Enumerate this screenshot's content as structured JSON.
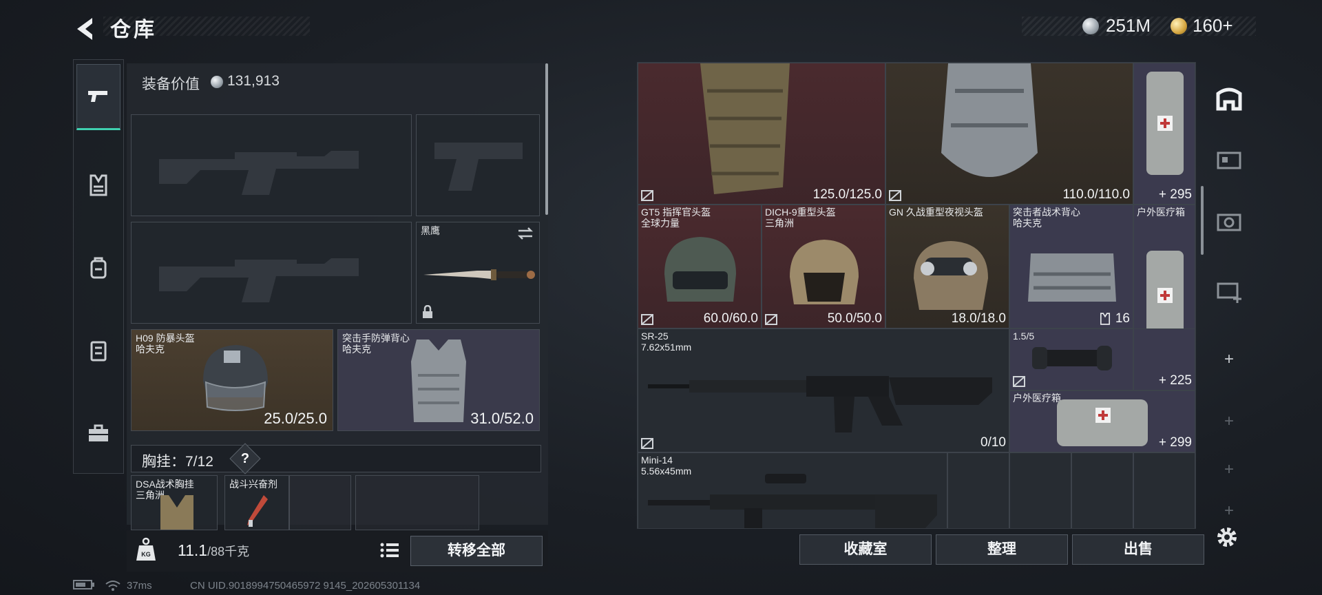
{
  "header": {
    "title": "仓库"
  },
  "currency": {
    "silver": "251M",
    "gold": "160+"
  },
  "loadout": {
    "equip_value_label": "装备价值",
    "equip_value": "131,913",
    "knife_name": "黑鹰",
    "helmet": {
      "name": "H09 防暴头盔",
      "map": "哈夫克",
      "durability": "25.0/25.0"
    },
    "armor": {
      "name": "突击手防弹背心",
      "map": "哈夫克",
      "durability": "31.0/52.0"
    },
    "rig_label": "胸挂：7/12",
    "rig_help": "?",
    "rig_items": [
      {
        "name": "DSA战术胸挂",
        "map": "三角洲"
      },
      {
        "name": "战斗兴奋剂",
        "map": ""
      }
    ],
    "weight": "11.1",
    "weight_unit": "/88千克",
    "transfer_all": "转移全部"
  },
  "stash": {
    "top_row": [
      {
        "val": "125.0/125.0"
      },
      {
        "val": "110.0/110.0"
      },
      {
        "val": "+ 295"
      }
    ],
    "helmets": [
      {
        "name": "GT5 指挥官头盔",
        "map": "全球力量",
        "val": "60.0/60.0"
      },
      {
        "name": "DICH-9重型头盔",
        "map": "三角洲",
        "val": "50.0/50.0"
      },
      {
        "name": "GN 久战重型夜视头盔",
        "map": "",
        "val": "18.0/18.0"
      },
      {
        "name": "突击者战术背心",
        "map": "哈夫克",
        "val": "16"
      },
      {
        "name": "户外医疗箱",
        "map": "",
        "val": ""
      }
    ],
    "sr25": {
      "name": "SR-25",
      "caliber": "7.62x51mm",
      "val": "0/10"
    },
    "scope": {
      "name": "1.5/5",
      "val": "+ 225"
    },
    "medkit2": {
      "name": "户外医疗箱",
      "val": "+ 299"
    },
    "mini14": {
      "name": "Mini-14",
      "caliber": "5.56x45mm"
    }
  },
  "actions": {
    "collection": "收藏室",
    "sort": "整理",
    "sell": "出售"
  },
  "status": {
    "ping": "37ms",
    "uid": "CN UID.9018994750465972 9145_202605301134"
  },
  "icons": [
    "back-arrow-icon",
    "silver-coin-icon",
    "gold-coin-icon",
    "pistol-icon",
    "rig-icon",
    "backpack-icon",
    "case-icon",
    "toolbox-icon",
    "swap-icon",
    "lock-icon",
    "weight-icon",
    "list-icon",
    "home-icon",
    "gear-icon",
    "plus-icon"
  ]
}
